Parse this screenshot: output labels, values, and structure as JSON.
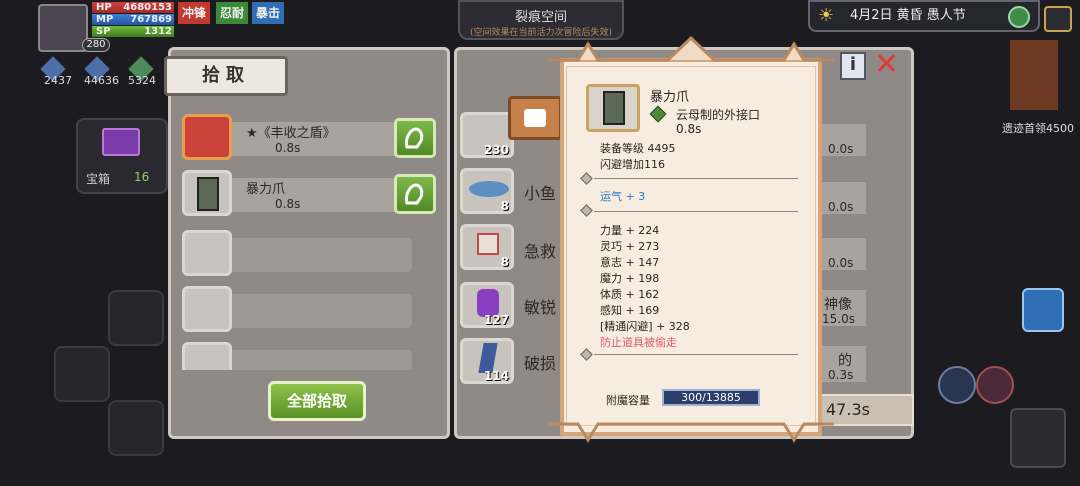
{
  "hud": {
    "hp_label": "HP",
    "hp_value": "4680153",
    "mp_label": "MP",
    "mp_value": "767869",
    "sp_label": "SP",
    "sp_value": "1312",
    "level": "280",
    "tags": [
      "冲锋",
      "忍耐",
      "暴击"
    ],
    "stats": [
      "2437",
      "44636",
      "5324"
    ],
    "chest_label": "宝箱",
    "chest_count": "16"
  },
  "event": {
    "title": "裂痕空间",
    "subtitle": "(空间效果在当前活力次冒险后失效)"
  },
  "date": {
    "text": "4月2日  黄昏  愚人节"
  },
  "right": {
    "boss_text": "遗迹首领4500"
  },
  "loot": {
    "title": "拾取",
    "items": [
      {
        "name": "★《丰收之盾》",
        "time": "0.8s"
      },
      {
        "name": "暴力爪",
        "time": "0.8s"
      }
    ],
    "pickall_label": "全部拾取"
  },
  "right_list": {
    "items": [
      {
        "count": "230",
        "name": "",
        "time": "0.0s"
      },
      {
        "count": "8",
        "name": "小鱼",
        "time": "0.0s"
      },
      {
        "count": "8",
        "name": "急救",
        "time": "0.0s"
      },
      {
        "count": "127",
        "name": "敏锐",
        "time": "15.0s",
        "extra": "神像"
      },
      {
        "count": "114",
        "name": "破损",
        "time": "0.3s",
        "extra": "的"
      }
    ],
    "bottom_time": "47.3s"
  },
  "tooltip": {
    "name": "暴力爪",
    "sub": "云母制的外接口",
    "time": "0.8s",
    "gear_level": "装备等级 4495",
    "dodge": "闪避增加116",
    "luck": "运气 + 3",
    "stats": [
      "力量 + 224",
      "灵巧 + 273",
      "意志 + 147",
      "魔力 + 198",
      "体质 + 162",
      "感知 + 169",
      "[精通闪避] + 328"
    ],
    "special": "防止道具被偷走",
    "ench_label": "附魔容量",
    "ench_value": "300/13885"
  },
  "colors": {
    "hp": "#d24040",
    "mp": "#3b7fd6",
    "sp": "#6fba3b",
    "luck": "#2d79c4",
    "special": "#e0586b",
    "green_btn": "#6fa63a"
  }
}
